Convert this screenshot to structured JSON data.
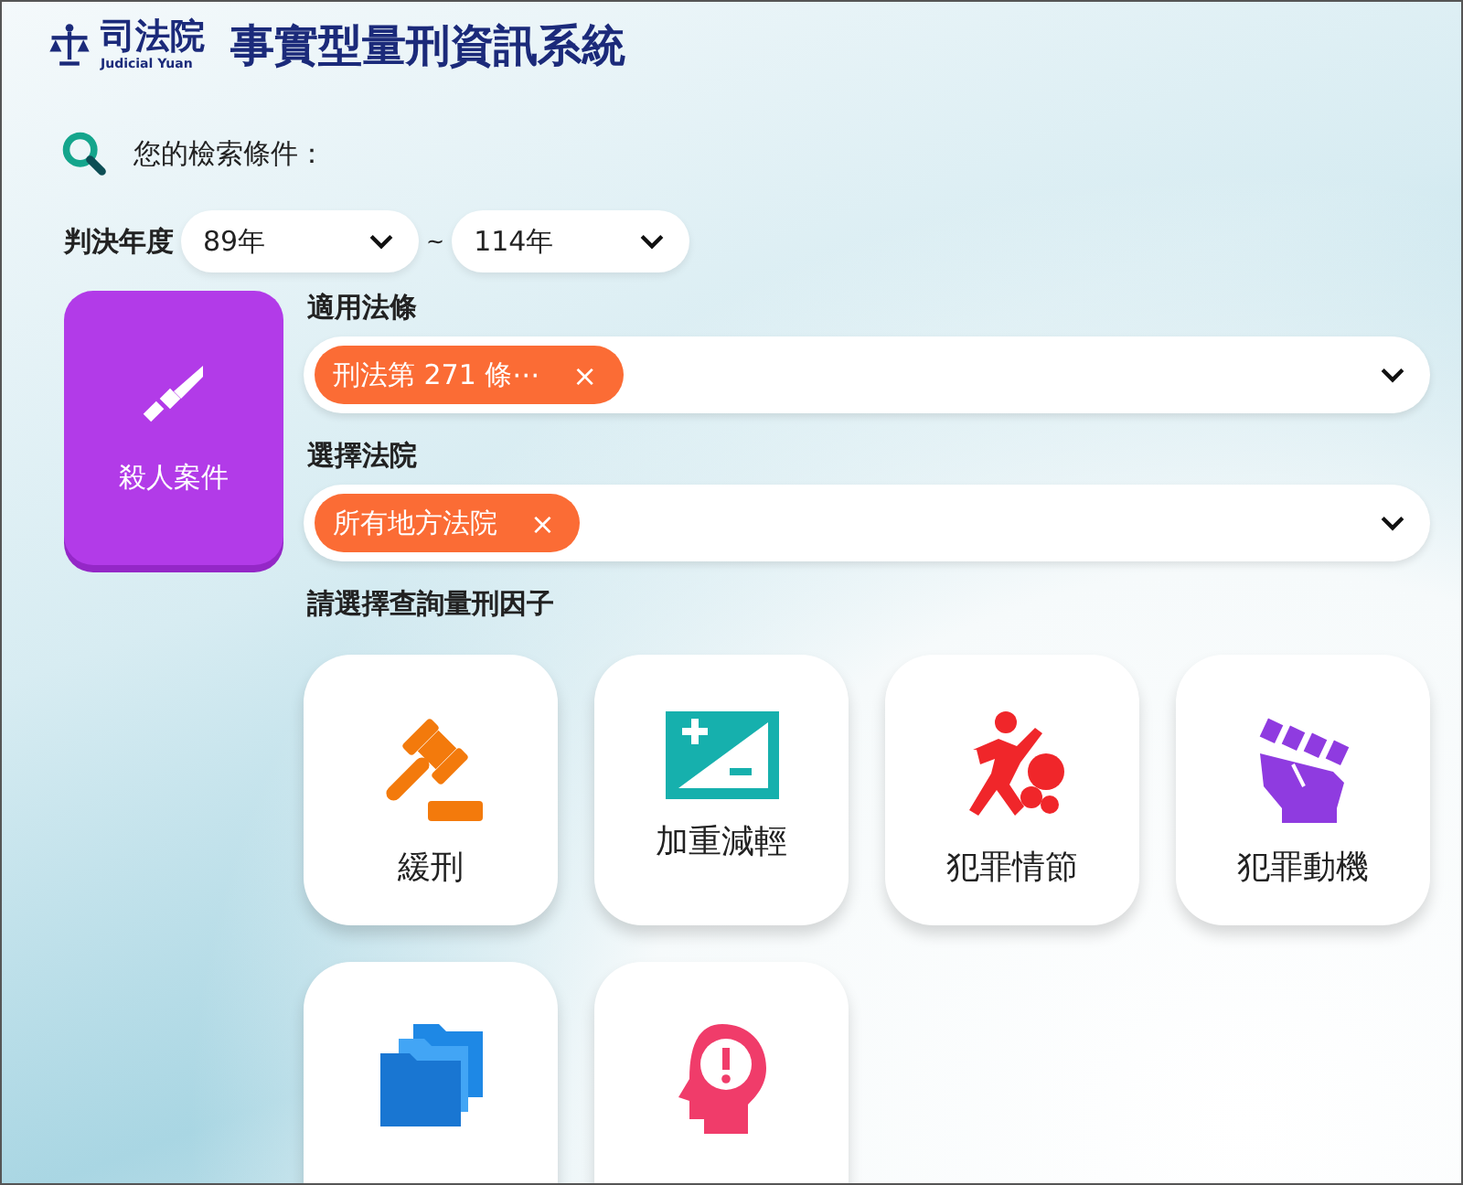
{
  "header": {
    "org_name": "司法院",
    "org_name_en": "Judicial Yuan",
    "title": "事實型量刑資訊系統"
  },
  "search_heading": "您的檢索條件：",
  "year_filter": {
    "label": "判決年度",
    "from": "89年",
    "separator": "~",
    "to": "114年"
  },
  "case_type": {
    "label": "殺人案件"
  },
  "filters": [
    {
      "label": "適用法條",
      "tags": [
        {
          "text": "刑法第 271 條⋯",
          "remove": "×"
        }
      ]
    },
    {
      "label": "選擇法院",
      "tags": [
        {
          "text": "所有地方法院",
          "remove": "×"
        }
      ]
    }
  ],
  "factors_heading": "請選擇查詢量刑因子",
  "factors": [
    {
      "kind": "gavel",
      "label": "緩刑"
    },
    {
      "kind": "plusminus",
      "label": "加重減輕"
    },
    {
      "kind": "fight",
      "label": "犯罪情節"
    },
    {
      "kind": "fist",
      "label": "犯罪動機"
    },
    {
      "kind": "folders"
    },
    {
      "kind": "head"
    }
  ]
}
